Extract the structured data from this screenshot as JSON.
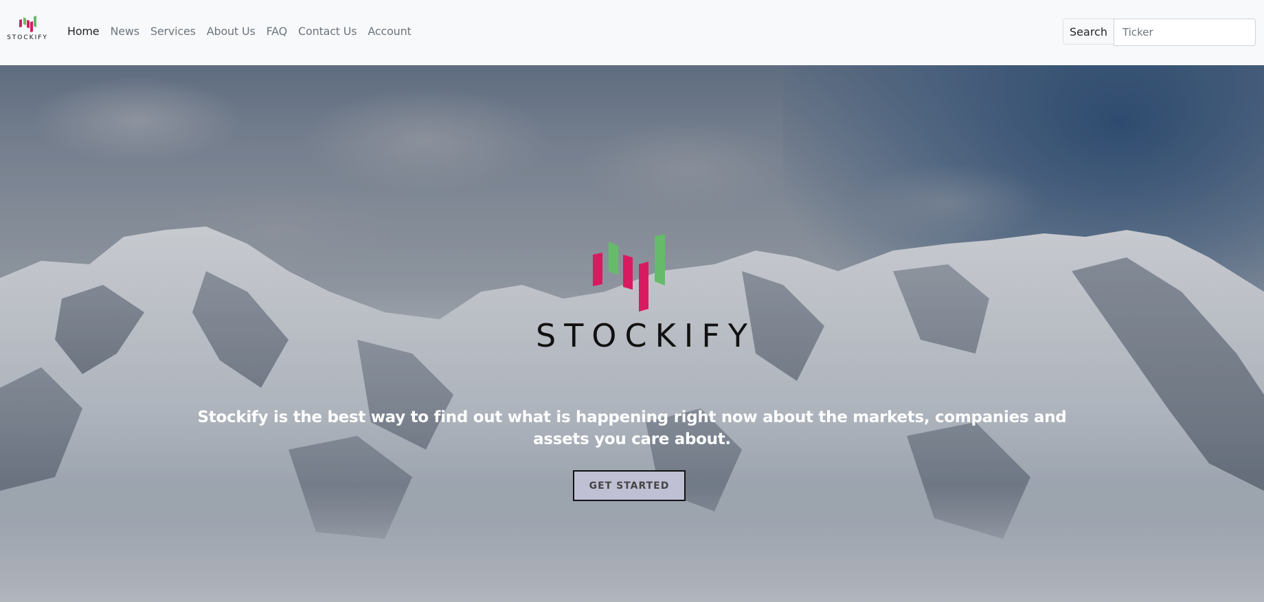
{
  "brand": {
    "name": "STOCKIFY",
    "logo_icon": "stockify-bars-logo",
    "colors": {
      "pink": "#d81b60",
      "green": "#66bb6a"
    }
  },
  "nav": {
    "items": [
      {
        "label": "Home",
        "active": true
      },
      {
        "label": "News",
        "active": false
      },
      {
        "label": "Services",
        "active": false
      },
      {
        "label": "About Us",
        "active": false
      },
      {
        "label": "FAQ",
        "active": false
      },
      {
        "label": "Contact Us",
        "active": false
      },
      {
        "label": "Account",
        "active": false
      }
    ]
  },
  "search": {
    "button_label": "Search",
    "placeholder": "Ticker"
  },
  "hero": {
    "logo_word": "STOCKIFY",
    "tagline": "Stockify is the best way to find out what is happening right now about the markets, companies and assets you care about.",
    "cta_label": "GET STARTED"
  }
}
